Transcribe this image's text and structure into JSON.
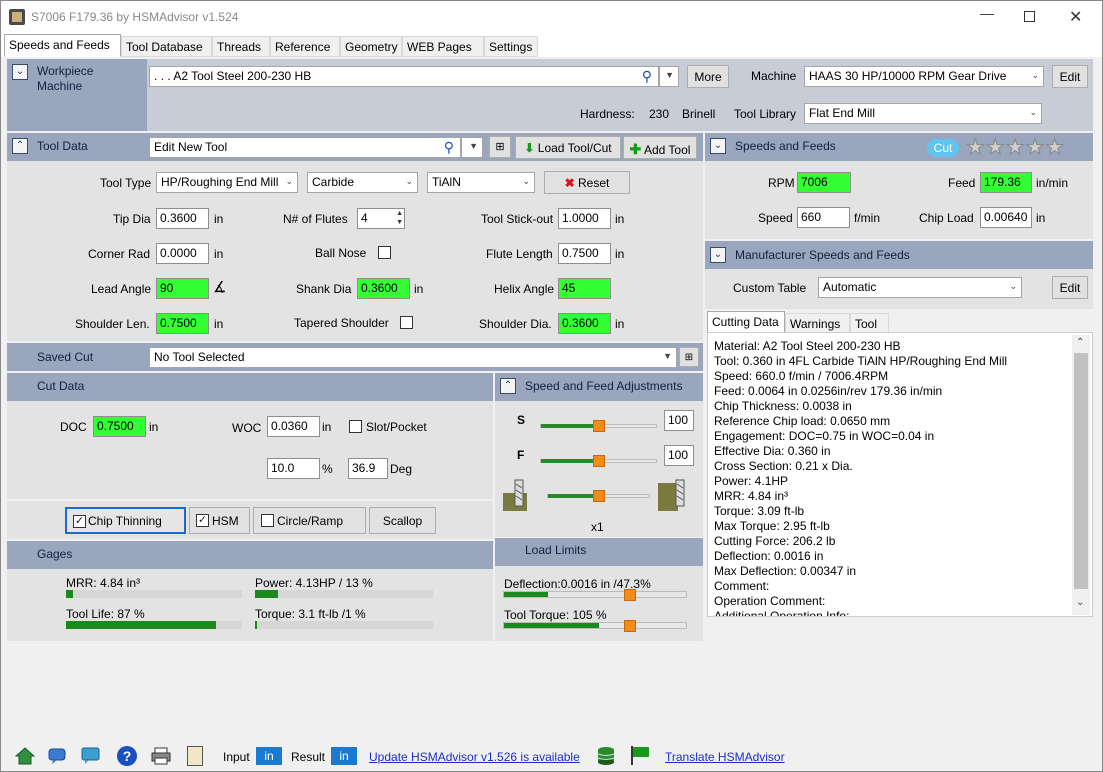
{
  "window": {
    "title": "S7006 F179.36 by HSMAdvisor v1.524"
  },
  "tabs": [
    "Speeds and Feeds",
    "Tool Database",
    "Threads",
    "Reference",
    "Geometry",
    "WEB Pages",
    "Settings"
  ],
  "workpiece": {
    "header_line1": "Workpiece",
    "header_line2": "Machine",
    "material": ". . . A2 Tool Steel 200-230 HB",
    "more_label": "More",
    "machine_label": "Machine",
    "machine_value": "HAAS 30 HP/10000 RPM Gear Drive",
    "edit_label": "Edit",
    "hardness_label": "Hardness:",
    "hardness_value": "230",
    "hardness_unit": "Brinell",
    "tool_library_label": "Tool Library",
    "tool_library_value": "Flat End Mill"
  },
  "tool_data": {
    "header": "Tool Data",
    "tool_name": "Edit New Tool",
    "load_label": "Load Tool/Cut",
    "add_label": "Add Tool",
    "tool_type_label": "Tool Type",
    "tool_type": "HP/Roughing End Mill",
    "material": "Carbide",
    "coating": "TiAlN",
    "reset_label": "Reset",
    "tip_dia_label": "Tip Dia",
    "tip_dia": "0.3600",
    "flutes_label": "N# of Flutes",
    "flutes": "4",
    "stickout_label": "Tool Stick-out",
    "stickout": "1.0000",
    "corner_rad_label": "Corner Rad",
    "corner_rad": "0.0000",
    "ball_nose_label": "Ball Nose",
    "flute_length_label": "Flute Length",
    "flute_length": "0.7500",
    "lead_angle_label": "Lead Angle",
    "lead_angle": "90",
    "shank_dia_label": "Shank Dia",
    "shank_dia": "0.3600",
    "helix_label": "Helix Angle",
    "helix": "45",
    "shoulder_len_label": "Shoulder Len.",
    "shoulder_len": "0.7500",
    "tapered_label": "Tapered Shoulder",
    "shoulder_dia_label": "Shoulder Dia.",
    "shoulder_dia": "0.3600",
    "unit": "in"
  },
  "saved_cut": {
    "label": "Saved Cut",
    "value": "No Tool Selected"
  },
  "cut_data": {
    "header": "Cut Data",
    "doc_label": "DOC",
    "doc": "0.7500",
    "woc_label": "WOC",
    "woc": "0.0360",
    "slot_label": "Slot/Pocket",
    "woc_percent": "10.0",
    "percent_sign": "%",
    "angle": "36.9",
    "angle_unit": "Deg",
    "unit": "in"
  },
  "options": {
    "chip_thinning": "Chip Thinning",
    "hsm": "HSM",
    "circle_ramp": "Circle/Ramp",
    "scallop": "Scallop"
  },
  "adjustments": {
    "header": "Speed and Feed Adjustments",
    "s_label": "S",
    "s_value": "100",
    "s_level": 0.5,
    "f_label": "F",
    "f_value": "100",
    "f_level": 0.5,
    "engagement_level": 0.5,
    "multiplier": "x1"
  },
  "gages": {
    "header": "Gages",
    "mrr": "MRR: 4.84 in³",
    "mrr_level": 0.04,
    "power": "Power: 4.13HP / 13 %",
    "power_level": 0.13,
    "tool_life": "Tool Life: 87 %",
    "tool_life_level": 0.85,
    "torque": "Torque: 3.1 ft-lb /1 %",
    "torque_level": 0.01
  },
  "load_limits": {
    "header": "Load Limits",
    "deflection": "Deflection:0.0016 in /47.3%",
    "deflection_level": 0.24,
    "torque": "Tool Torque: 105 %",
    "torque_level": 0.52
  },
  "speeds_feeds": {
    "header": "Speeds and Feeds",
    "cut_badge": "Cut",
    "rpm_label": "RPM",
    "rpm": "7006",
    "feed_label": "Feed",
    "feed": "179.36",
    "feed_unit": "in/min",
    "speed_label": "Speed",
    "speed": "660",
    "speed_unit": "f/min",
    "chip_load_label": "Chip Load",
    "chip_load": "0.00640",
    "chip_load_unit": "in"
  },
  "manufacturer": {
    "header": "Manufacturer Speeds and Feeds",
    "custom_label": "Custom Table",
    "custom_value": "Automatic",
    "edit_label": "Edit"
  },
  "info_tabs": [
    "Cutting Data",
    "Warnings",
    "Tool"
  ],
  "cutting_data_lines": [
    "Material: A2 Tool Steel 200-230 HB",
    "Tool: 0.360 in 4FL Carbide TiAlN HP/Roughing End Mill",
    "Speed: 660.0 f/min / 7006.4RPM",
    "Feed: 0.0064 in 0.0256in/rev 179.36 in/min",
    "Chip Thickness: 0.0038 in",
    "Reference Chip load: 0.0650 mm",
    "Engagement: DOC=0.75 in WOC=0.04 in",
    "Effective Dia: 0.360 in",
    "Cross Section: 0.21 x Dia.",
    "Power: 4.1HP",
    "MRR: 4.84 in³",
    "Torque: 3.09 ft-lb",
    "Max Torque: 2.95 ft-lb",
    "Cutting Force: 206.2 lb",
    "Deflection: 0.0016 in",
    "Max Deflection: 0.00347 in",
    "Comment:",
    "Operation Comment:",
    "Additional Operation Info:"
  ],
  "statusbar": {
    "input_label": "Input",
    "input_unit": "in",
    "result_label": "Result",
    "result_unit": "in",
    "update_link": "Update HSMAdvisor v1.526 is available",
    "translate_link": "Translate HSMAdvisor"
  }
}
